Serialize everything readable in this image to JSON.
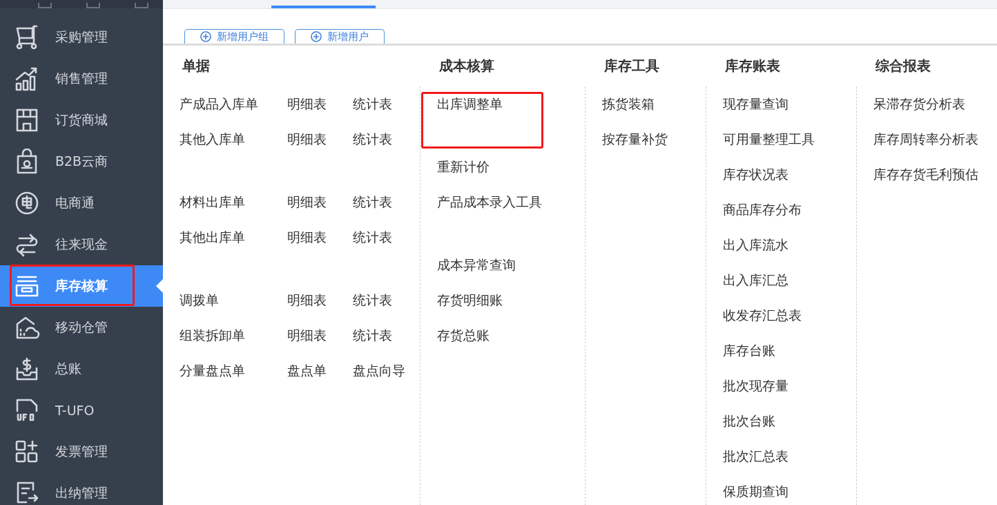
{
  "tabs": [
    {
      "selected": true
    }
  ],
  "sidebar": {
    "items": [
      {
        "label": "采购管理",
        "selected": false,
        "annotated": false
      },
      {
        "label": "销售管理",
        "selected": false,
        "annotated": false
      },
      {
        "label": "订货商城",
        "selected": false,
        "annotated": false
      },
      {
        "label": "B2B云商",
        "selected": false,
        "annotated": false
      },
      {
        "label": "电商通",
        "selected": false,
        "annotated": false
      },
      {
        "label": "往来现金",
        "selected": false,
        "annotated": false
      },
      {
        "label": "库存核算",
        "selected": true,
        "annotated": true
      },
      {
        "label": "移动仓管",
        "selected": false,
        "annotated": false
      },
      {
        "label": "总账",
        "selected": false,
        "annotated": false
      },
      {
        "label": "T-UFO",
        "selected": false,
        "annotated": false
      },
      {
        "label": "发票管理",
        "selected": false,
        "annotated": false
      },
      {
        "label": "出纳管理",
        "selected": false,
        "annotated": false
      }
    ]
  },
  "buttons": [
    "新增用户组",
    "新增用户"
  ],
  "menu": {
    "columns": [
      {
        "title": "单据",
        "items": [
          {
            "kind": "row",
            "links": [
              "产成品入库单",
              "明细表",
              "统计表"
            ]
          },
          {
            "kind": "row",
            "links": [
              "其他入库单",
              "明细表",
              "统计表"
            ]
          },
          {
            "kind": "gap"
          },
          {
            "kind": "row",
            "links": [
              "材料出库单",
              "明细表",
              "统计表"
            ]
          },
          {
            "kind": "row",
            "links": [
              "其他出库单",
              "明细表",
              "统计表"
            ]
          },
          {
            "kind": "gap"
          },
          {
            "kind": "row",
            "links": [
              "调拨单",
              "明细表",
              "统计表"
            ]
          },
          {
            "kind": "row",
            "links": [
              "组装拆卸单",
              "明细表",
              "统计表"
            ]
          },
          {
            "kind": "row",
            "links": [
              "分量盘点单",
              "盘点单",
              "盘点向导"
            ]
          }
        ]
      },
      {
        "title": "成本核算",
        "items": [
          {
            "kind": "link",
            "label": "出库调整单",
            "annotated": true
          },
          {
            "kind": "gap"
          },
          {
            "kind": "link",
            "label": "重新计价",
            "annotated": false
          },
          {
            "kind": "link",
            "label": "产品成本录入工具",
            "annotated": false
          },
          {
            "kind": "gap"
          },
          {
            "kind": "link",
            "label": "成本异常查询",
            "annotated": false
          },
          {
            "kind": "link",
            "label": "存货明细账",
            "annotated": false
          },
          {
            "kind": "link",
            "label": "存货总账",
            "annotated": false
          }
        ]
      },
      {
        "title": "库存工具",
        "items": [
          {
            "kind": "link",
            "label": "拣货装箱",
            "annotated": false
          },
          {
            "kind": "link",
            "label": "按存量补货",
            "annotated": false
          }
        ]
      },
      {
        "title": "库存账表",
        "items": [
          {
            "kind": "link",
            "label": "现存量查询",
            "annotated": false
          },
          {
            "kind": "link",
            "label": "可用量整理工具",
            "annotated": false
          },
          {
            "kind": "link",
            "label": "库存状况表",
            "annotated": false
          },
          {
            "kind": "link",
            "label": "商品库存分布",
            "annotated": false
          },
          {
            "kind": "link",
            "label": "出入库流水",
            "annotated": false
          },
          {
            "kind": "link",
            "label": "出入库汇总",
            "annotated": false
          },
          {
            "kind": "link",
            "label": "收发存汇总表",
            "annotated": false
          },
          {
            "kind": "link",
            "label": "库存台账",
            "annotated": false
          },
          {
            "kind": "link",
            "label": "批次现存量",
            "annotated": false
          },
          {
            "kind": "link",
            "label": "批次台账",
            "annotated": false
          },
          {
            "kind": "link",
            "label": "批次汇总表",
            "annotated": false
          },
          {
            "kind": "link",
            "label": "保质期查询",
            "annotated": false
          }
        ]
      },
      {
        "title": "综合报表",
        "items": [
          {
            "kind": "link",
            "label": "呆滞存货分析表",
            "annotated": false
          },
          {
            "kind": "link",
            "label": "库存周转率分析表",
            "annotated": false
          },
          {
            "kind": "link",
            "label": "库存存货毛利预估",
            "annotated": false
          }
        ]
      }
    ]
  }
}
